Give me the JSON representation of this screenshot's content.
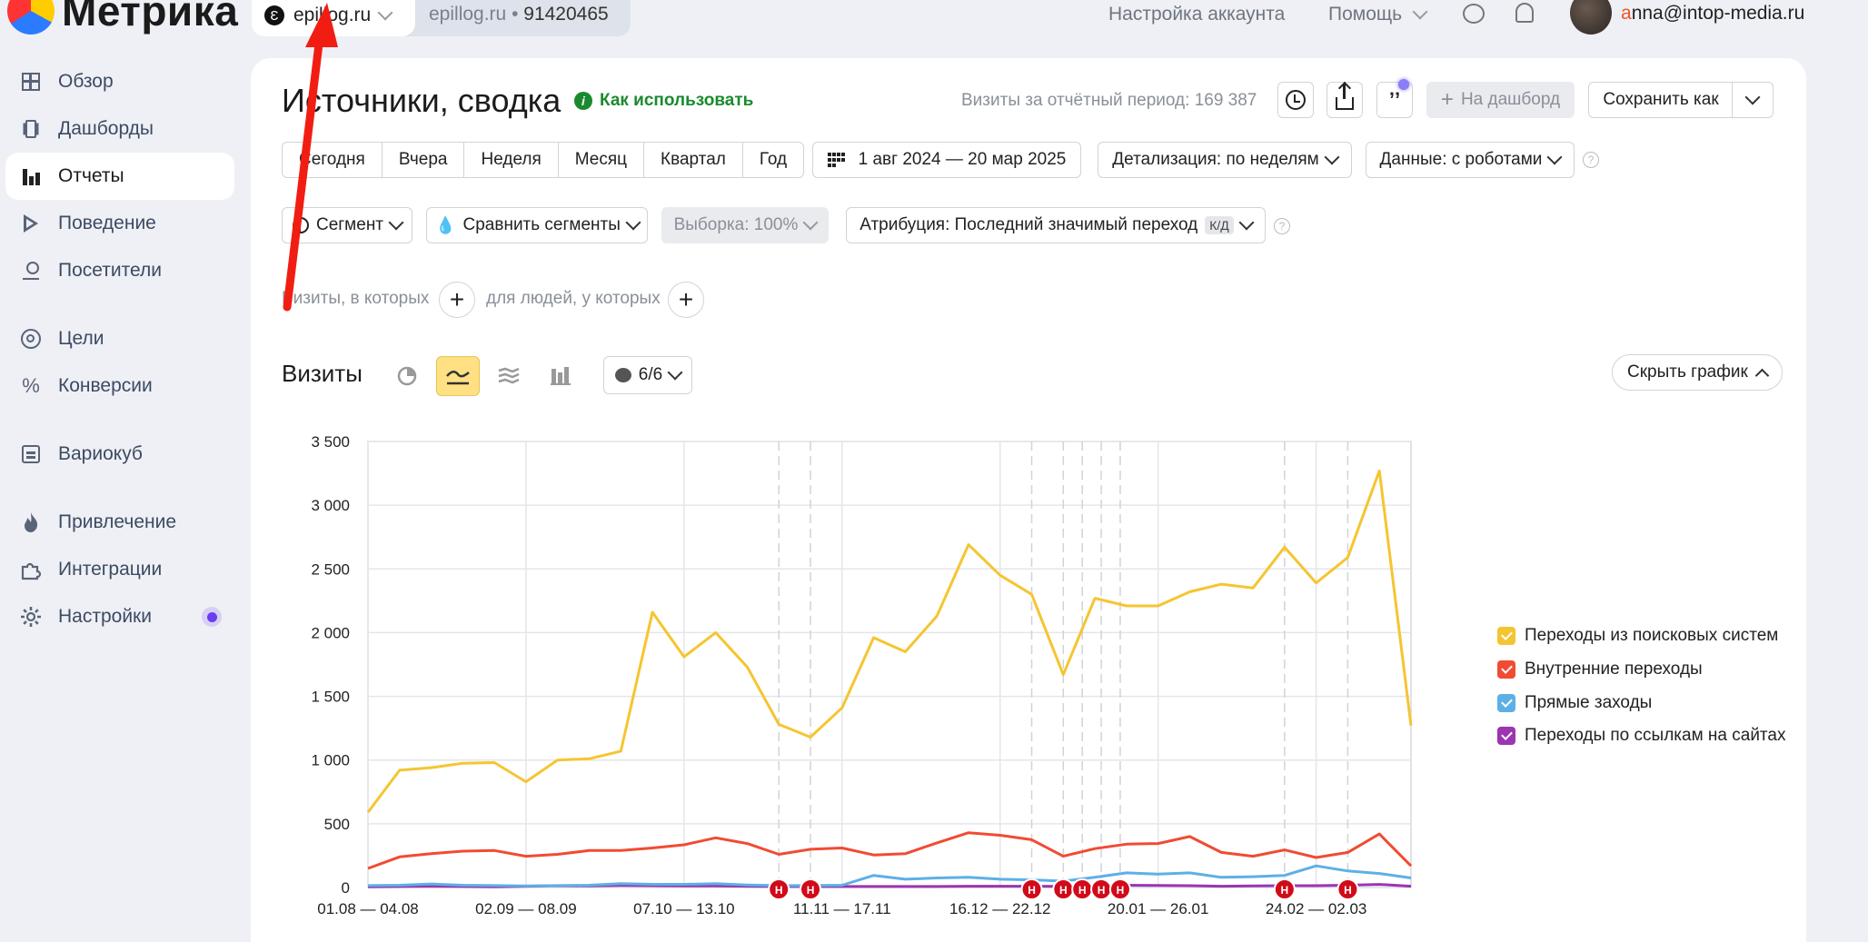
{
  "app": {
    "logo_text": "Метрика"
  },
  "header": {
    "site_name": "epillog.ru",
    "other_site": "epillog.ru",
    "counter_id": "91420465",
    "account_settings": "Настройка аккаунта",
    "help": "Помощь",
    "user_first": "a",
    "user_rest": "nna@intop-media.ru"
  },
  "sidebar": {
    "items": [
      {
        "label": "Обзор",
        "icon": "grid-icon"
      },
      {
        "label": "Дашборды",
        "icon": "dashboard-icon"
      },
      {
        "label": "Отчеты",
        "icon": "bar-chart-icon",
        "active": true
      },
      {
        "label": "Поведение",
        "icon": "play-icon"
      },
      {
        "label": "Посетители",
        "icon": "person-icon"
      },
      {
        "label": "Цели",
        "icon": "target-icon"
      },
      {
        "label": "Конверсии",
        "icon": "percent-icon"
      },
      {
        "label": "Вариокуб",
        "icon": "cube-icon"
      },
      {
        "label": "Привлечение",
        "icon": "fire-icon"
      },
      {
        "label": "Интеграции",
        "icon": "puzzle-icon"
      },
      {
        "label": "Настройки",
        "icon": "gear-icon"
      }
    ]
  },
  "report": {
    "title": "Источники, сводка",
    "howto": "Как использовать",
    "visits_total": "Визиты за отчётный период: 169 387",
    "to_dashboard": "На дашборд",
    "save_as": "Сохранить как"
  },
  "period": {
    "presets": [
      "Сегодня",
      "Вчера",
      "Неделя",
      "Месяц",
      "Квартал",
      "Год"
    ],
    "range": "1 авг 2024 — 20 мар 2025",
    "detail": "Детализация: по неделям",
    "data_mode": "Данные: с роботами"
  },
  "filters": {
    "segment": "Сегмент",
    "compare": "Сравнить сегменты",
    "sample": "Выборка: 100%",
    "attribution": "Атрибуция: Последний значимый переход",
    "attribution_badge": "К/Д",
    "visits_where": "Визиты, в которых",
    "people_where": "для людей, у которых"
  },
  "chart_section": {
    "title": "Визиты",
    "series_count": "6/6",
    "hide_chart": "Скрыть график"
  },
  "chart_data": {
    "type": "line",
    "ylim": [
      0,
      3500
    ],
    "yticks": [
      0,
      500,
      1000,
      1500,
      2000,
      2500,
      3000,
      3500
    ],
    "ytick_labels": [
      "0",
      "500",
      "1 000",
      "1 500",
      "2 000",
      "2 500",
      "3 000",
      "3 500"
    ],
    "xtick_labels": [
      "01.08 — 04.08",
      "02.09 — 08.09",
      "07.10 — 13.10",
      "11.11 — 17.11",
      "16.12 — 22.12",
      "20.01 — 26.01",
      "24.02 — 02.03"
    ],
    "xtick_index": [
      0,
      5,
      10,
      15,
      20,
      25,
      30
    ],
    "annotation_marker": "Н",
    "annotation_index": [
      13,
      14,
      21,
      22,
      22.6,
      23.2,
      23.8,
      29,
      31
    ],
    "series": [
      {
        "name": "Переходы из поисковых систем",
        "color": "#f5c531",
        "values": [
          590,
          920,
          940,
          975,
          980,
          830,
          1000,
          1010,
          1070,
          2160,
          1810,
          2000,
          1730,
          1280,
          1180,
          1410,
          1960,
          1850,
          2130,
          2690,
          2450,
          2300,
          1670,
          2270,
          2210,
          2210,
          2320,
          2380,
          2350,
          2670,
          2390,
          2590,
          3270,
          1270
        ]
      },
      {
        "name": "Внутренние переходы",
        "color": "#f14b33",
        "values": [
          150,
          240,
          265,
          285,
          290,
          245,
          260,
          290,
          290,
          310,
          335,
          390,
          345,
          260,
          300,
          310,
          255,
          265,
          350,
          430,
          410,
          375,
          245,
          305,
          340,
          345,
          400,
          275,
          245,
          295,
          235,
          275,
          420,
          170
        ]
      },
      {
        "name": "Прямые заходы",
        "color": "#5cb0e6",
        "values": [
          15,
          18,
          28,
          18,
          15,
          12,
          15,
          18,
          30,
          25,
          25,
          30,
          20,
          15,
          15,
          18,
          95,
          65,
          75,
          80,
          65,
          60,
          50,
          80,
          115,
          105,
          115,
          80,
          85,
          95,
          170,
          130,
          110,
          75
        ]
      },
      {
        "name": "Переходы по ссылкам на сайтах",
        "color": "#9b35b0",
        "values": [
          5,
          8,
          10,
          8,
          6,
          10,
          14,
          12,
          16,
          14,
          12,
          12,
          10,
          8,
          8,
          8,
          8,
          8,
          8,
          10,
          10,
          10,
          8,
          12,
          18,
          16,
          14,
          10,
          12,
          14,
          14,
          18,
          24,
          10
        ]
      }
    ]
  }
}
